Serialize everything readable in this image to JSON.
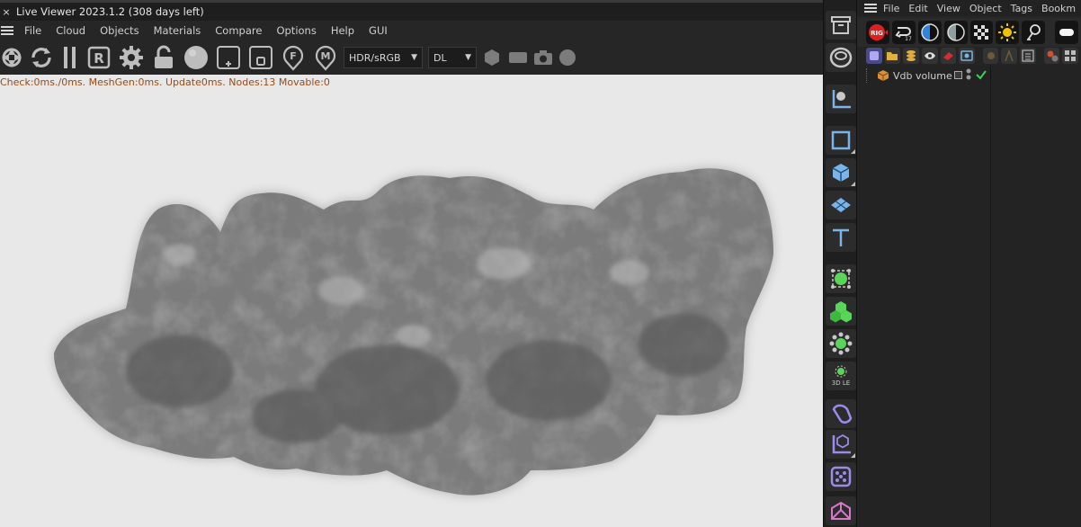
{
  "live_viewer": {
    "title": "Live Viewer 2023.1.2 (308 days left)",
    "close_glyph": "×",
    "menu": [
      "File",
      "Cloud",
      "Objects",
      "Materials",
      "Compare",
      "Options",
      "Help",
      "GUI"
    ],
    "toolbar_icons": [
      "aperture-icon",
      "refresh-icon",
      "pause-icon",
      "region-r-icon",
      "settings-gear-icon",
      "lock-icon",
      "sphere-icon",
      "add-window-icon",
      "window-icon",
      "pin-f-icon",
      "pin-m-icon"
    ],
    "color_space": "HDR/sRGB",
    "render_mode": "DL",
    "trailing_icons": [
      "hexagon-icon",
      "rectangle-icon",
      "camera-icon",
      "circle-icon"
    ],
    "status_text": "Check:0ms./0ms. MeshGen:0ms. Update0ms. Nodes:13 Movable:0"
  },
  "palette": {
    "items": [
      {
        "name": "archive-icon",
        "color": "#c8c8c8"
      },
      {
        "name": "torus-icon",
        "color": "#c8c8c8"
      },
      {
        "name": "coordinate-system-icon",
        "color": "#7ab4e8"
      },
      {
        "name": "rectangle-spline-icon",
        "color": "#7ab4e8"
      },
      {
        "name": "cube-icon",
        "color": "#7ab4e8"
      },
      {
        "name": "plane-icon",
        "color": "#7ab4e8"
      },
      {
        "name": "text-icon",
        "color": "#7ab4e8"
      },
      {
        "name": "subdivision-icon",
        "color": "#5ad45a"
      },
      {
        "name": "cloner-icon",
        "color": "#5ad45a"
      },
      {
        "name": "effector-gear-icon",
        "color": "#5ad45a"
      },
      {
        "name": "field-icon",
        "color": "#5ad45a"
      },
      {
        "name": "deformer-bend-icon",
        "color": "#9a8ce8"
      },
      {
        "name": "null-object-icon",
        "color": "#9a8ce8"
      },
      {
        "name": "dice-icon",
        "color": "#9a8ce8"
      },
      {
        "name": "fracture-icon",
        "color": "#d878c8"
      }
    ]
  },
  "object_manager": {
    "menu": [
      "File",
      "Edit",
      "View",
      "Object",
      "Tags",
      "Bookm"
    ],
    "toolbar": [
      {
        "name": "rig-icon",
        "label": "RIG"
      },
      {
        "name": "undo-17-icon",
        "label": "17"
      },
      {
        "name": "contrast-blue-icon",
        "label": ""
      },
      {
        "name": "contrast-gray-icon",
        "label": ""
      },
      {
        "name": "checker-icon",
        "label": ""
      },
      {
        "name": "sun-icon",
        "label": ""
      },
      {
        "name": "lightbulb-icon",
        "label": ""
      },
      {
        "name": "area-light-icon",
        "label": ""
      }
    ],
    "filters": [
      "cube-filter-icon",
      "folder-filter-icon",
      "stack-filter-icon",
      "eye-filter-icon",
      "eraser-filter-icon",
      "camera-filter-icon",
      "star-filter-icon",
      "person-filter-icon",
      "list-filter-icon",
      "tag-filter-icon",
      "grid-filter-icon"
    ],
    "objects": [
      {
        "name": "Vdb volume",
        "icon": "vdb-volume-icon"
      }
    ]
  },
  "colors": {
    "status_text": "#9a4a16",
    "viewport_bg": "#e8e8e8",
    "checkmark": "#3fcf5a",
    "rig_red": "#e02020"
  }
}
